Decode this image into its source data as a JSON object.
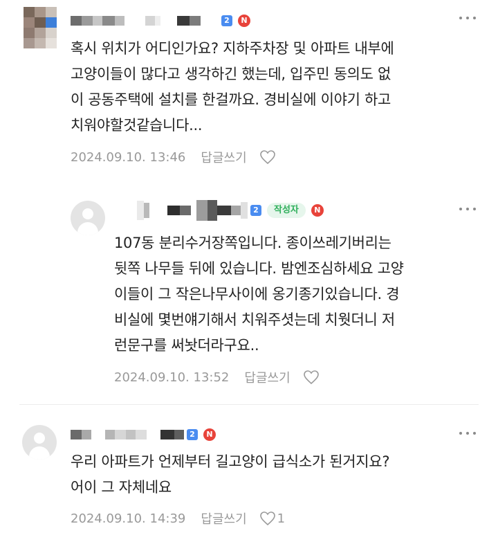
{
  "comments": [
    {
      "level": "2",
      "n_badge": "N",
      "text": "혹시 위치가 어디인가요? 지하주차장 및 아파트 내부에\n고양이들이 많다고 생각하긴 했는데, 입주민 동의도 없\n이 공동주택에 설치를 한걸까요. 경비실에 이야기 하고\n치워야할것같습니다...",
      "timestamp": "2024.09.10. 13:46",
      "reply_label": "답글쓰기",
      "likes": ""
    },
    {
      "level": "2",
      "author_badge": "작성자",
      "n_badge": "N",
      "text": "107동 분리수거장쪽입니다. 종이쓰레기버리는\n뒷쪽 나무들 뒤에 있습니다. 밤엔조심하세요 고양\n이들이 그 작은나무사이에 옹기종기있습니다. 경\n비실에 몇번얘기해서 치워주셧는데 치웟더니 저\n런문구를 써놧더라구요..",
      "timestamp": "2024.09.10. 13:52",
      "reply_label": "답글쓰기",
      "likes": ""
    },
    {
      "level": "2",
      "n_badge": "N",
      "text": "우리 아파트가 언제부터 길고양이 급식소가 된거지요?\n어이 그 자체네요",
      "timestamp": "2024.09.10. 14:39",
      "reply_label": "답글쓰기",
      "likes": "1"
    }
  ],
  "icons": {
    "more": "more-horizontal-icon",
    "like": "heart-outline-icon",
    "avatar": "default-avatar-icon"
  },
  "colors": {
    "level_badge": "#4a8cf0",
    "n_badge": "#e8433a",
    "author_badge_bg": "#e6f6ec",
    "author_badge_text": "#2faf5b",
    "meta_text": "#999999"
  }
}
